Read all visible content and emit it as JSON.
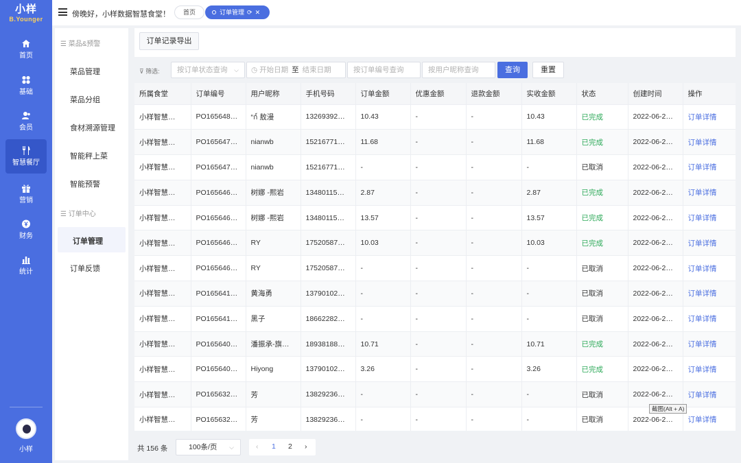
{
  "brand": {
    "name": "小样",
    "sub": "B.Younger"
  },
  "rail": {
    "items": [
      {
        "label": "首页",
        "icon": "home-icon"
      },
      {
        "label": "基础",
        "icon": "grid-icon"
      },
      {
        "label": "会员",
        "icon": "user-icon"
      },
      {
        "label": "智慧餐厅",
        "icon": "fork-knife-icon"
      },
      {
        "label": "营销",
        "icon": "gift-icon"
      },
      {
        "label": "财务",
        "icon": "currency-icon"
      },
      {
        "label": "统计",
        "icon": "bar-chart-icon"
      }
    ],
    "active": "智慧餐厅",
    "user": "小样"
  },
  "topbar": {
    "greeting": "傍晚好，小样数据智慧食堂！",
    "tabs": [
      {
        "label": "首页"
      },
      {
        "label": "订单管理",
        "icons": [
          "refresh-icon",
          "close-icon"
        ]
      }
    ]
  },
  "subnav": {
    "group1": "菜品&预警",
    "items1": [
      "菜品管理",
      "菜品分组",
      "食材溯源管理",
      "智能秤上菜",
      "智能预警"
    ],
    "group2": "订单中心",
    "items2": [
      "订单管理",
      "订单反馈"
    ],
    "active": "订单管理"
  },
  "toolbar": {
    "export_label": "订单记录导出"
  },
  "filters": {
    "label": "筛选:",
    "status_placeholder": "按订单状态查询",
    "date_start": "开始日期",
    "date_sep": "至",
    "date_end": "结束日期",
    "order_placeholder": "按订单编号查询",
    "nick_placeholder": "按用户昵称查询",
    "query_label": "查询",
    "reset_label": "重置"
  },
  "table": {
    "columns": [
      "所属食堂",
      "订单编号",
      "用户昵称",
      "手机号码",
      "订单金额",
      "优惠金额",
      "退款金额",
      "实收金额",
      "状态",
      "创建时间",
      "操作"
    ],
    "rows": [
      [
        "小样智慧…",
        "PO165648…",
        "“ก์ 敖漫",
        "13269392…",
        "10.43",
        "-",
        "-",
        "10.43",
        "已完成",
        "2022-06-2…",
        "订单详情"
      ],
      [
        "小样智慧…",
        "PO165647…",
        "nianwb",
        "15216771…",
        "11.68",
        "-",
        "-",
        "11.68",
        "已完成",
        "2022-06-2…",
        "订单详情"
      ],
      [
        "小样智慧…",
        "PO165647…",
        "nianwb",
        "15216771…",
        "-",
        "-",
        "-",
        "-",
        "已取消",
        "2022-06-2…",
        "订单详情"
      ],
      [
        "小样智慧…",
        "PO165646…",
        "树娜 -熙岩",
        "13480115…",
        "2.87",
        "-",
        "-",
        "2.87",
        "已完成",
        "2022-06-2…",
        "订单详情"
      ],
      [
        "小样智慧…",
        "PO165646…",
        "树娜 -熙岩",
        "13480115…",
        "13.57",
        "-",
        "-",
        "13.57",
        "已完成",
        "2022-06-2…",
        "订单详情"
      ],
      [
        "小样智慧…",
        "PO165646…",
        "RY",
        "17520587…",
        "10.03",
        "-",
        "-",
        "10.03",
        "已完成",
        "2022-06-2…",
        "订单详情"
      ],
      [
        "小样智慧…",
        "PO165646…",
        "RY",
        "17520587…",
        "-",
        "-",
        "-",
        "-",
        "已取消",
        "2022-06-2…",
        "订单详情"
      ],
      [
        "小样智慧…",
        "PO165641…",
        "黄海勇",
        "13790102…",
        "-",
        "-",
        "-",
        "-",
        "已取消",
        "2022-06-2…",
        "订单详情"
      ],
      [
        "小样智慧…",
        "PO165641…",
        "黑子",
        "18662282…",
        "-",
        "-",
        "-",
        "-",
        "已取消",
        "2022-06-2…",
        "订单详情"
      ],
      [
        "小样智慧…",
        "PO165640…",
        "潘振承-旗…",
        "18938188…",
        "10.71",
        "-",
        "-",
        "10.71",
        "已完成",
        "2022-06-2…",
        "订单详情"
      ],
      [
        "小样智慧…",
        "PO165640…",
        "Hiyong",
        "13790102…",
        "3.26",
        "-",
        "-",
        "3.26",
        "已完成",
        "2022-06-2…",
        "订单详情"
      ],
      [
        "小样智慧…",
        "PO165632…",
        "芳",
        "13829236…",
        "-",
        "-",
        "-",
        "-",
        "已取消",
        "2022-06-2…",
        "订单详情"
      ],
      [
        "小样智慧…",
        "PO165632…",
        "芳",
        "13829236…",
        "-",
        "-",
        "-",
        "-",
        "已取消",
        "2022-06-2…",
        "订单详情"
      ]
    ]
  },
  "tooltip": "截图(Alt + A)",
  "pagination": {
    "total": "共 156 条",
    "page_size": "100条/页",
    "pages": [
      "1",
      "2"
    ],
    "current": "1"
  },
  "colors": {
    "brand": "#4a6ee0",
    "done": "#2faa5a",
    "link": "#4a6ee0"
  }
}
